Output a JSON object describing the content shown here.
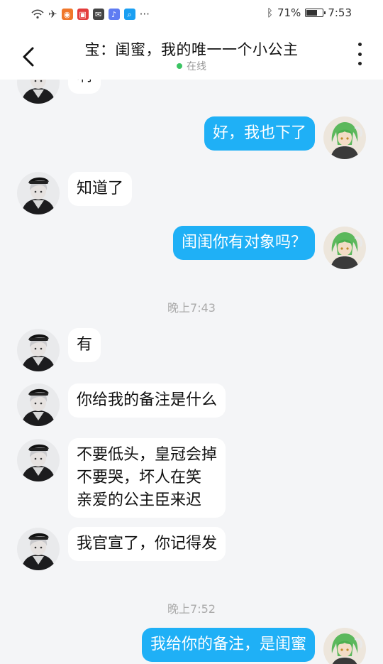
{
  "status_bar": {
    "battery": "71%",
    "battery_level": 0.71,
    "time": "7:53",
    "more": "···"
  },
  "header": {
    "title": "宝：闺蜜，我的唯一一个小公主",
    "status": "在线"
  },
  "messages": {
    "m0": "啊",
    "m1": "好，我也下了",
    "m2": "知道了",
    "m3": "闺闺你有对象吗？",
    "t1": "晚上7:43",
    "m4": "有",
    "m5": "你给我的备注是什么",
    "m6": {
      "line1": "不要低头，皇冠会掉",
      "line2": "不要哭，坏人在笑",
      "line3": "亲爱的公主臣来迟"
    },
    "m7": "我官宣了，你记得发",
    "t2": "晚上7:52",
    "m8": "我给你的备注，是闺蜜"
  },
  "colors": {
    "bubble_out": "#1fb0f6",
    "bubble_in": "#ffffff",
    "background": "#f4f5f7",
    "online": "#3bc463"
  }
}
